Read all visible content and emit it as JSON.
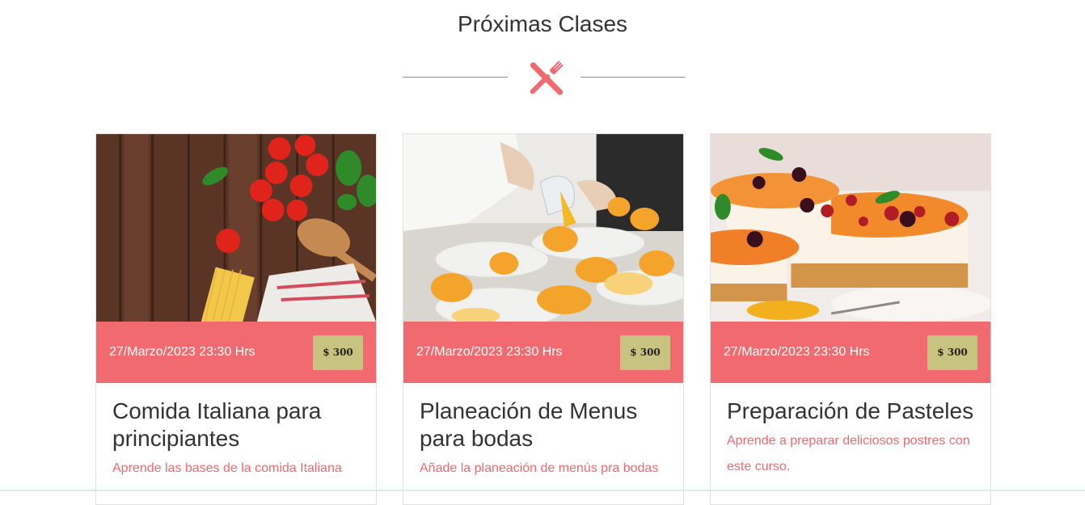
{
  "section": {
    "title": "Próximas Clases",
    "icon": "utensils-icon",
    "accent_color": "#f06a70"
  },
  "classes": [
    {
      "image": "tomatoes-pasta-photo",
      "date": "27/Marzo/2023 23:30 Hrs",
      "price": "$ 300",
      "title": "Comida Italiana para principiantes",
      "description": "Aprende las bases de la comida Italiana"
    },
    {
      "image": "chef-plating-photo",
      "date": "27/Marzo/2023 23:30 Hrs",
      "price": "$ 300",
      "title": "Planeación de Menus para bodas",
      "description": "Añade la planeación de menús pra bodas"
    },
    {
      "image": "cheesecake-photo",
      "date": "27/Marzo/2023 23:30 Hrs",
      "price": "$ 300",
      "title": "Preparación de Pasteles",
      "description": "Aprende a preparar deliciosos postres con este curso."
    }
  ]
}
